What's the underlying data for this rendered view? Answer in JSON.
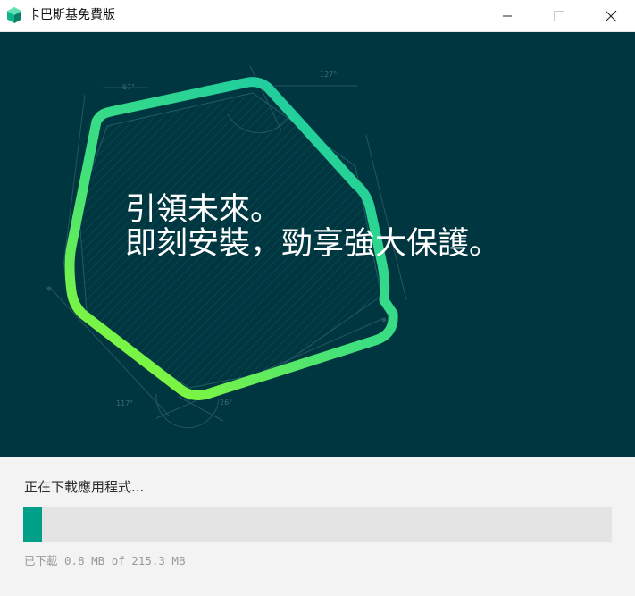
{
  "window": {
    "title": "卡巴斯基免費版",
    "controls": {
      "minimize_icon": "minimize-icon",
      "maximize_icon": "maximize-icon",
      "close_icon": "close-icon"
    }
  },
  "hero": {
    "line1": "引領未來。",
    "line2": "即刻安裝，勁享強大保護。",
    "background_color": "#00363f",
    "angle_labels": [
      "67°",
      "127°",
      "117°",
      "26°"
    ]
  },
  "download": {
    "status": "正在下載應用程式...",
    "progress_fraction": 0.0037,
    "downloaded_mb": "0.8",
    "total_mb": "215.3",
    "info": "已下載 0.8 MB of 215.3 MB",
    "accent_color": "#00a088"
  }
}
